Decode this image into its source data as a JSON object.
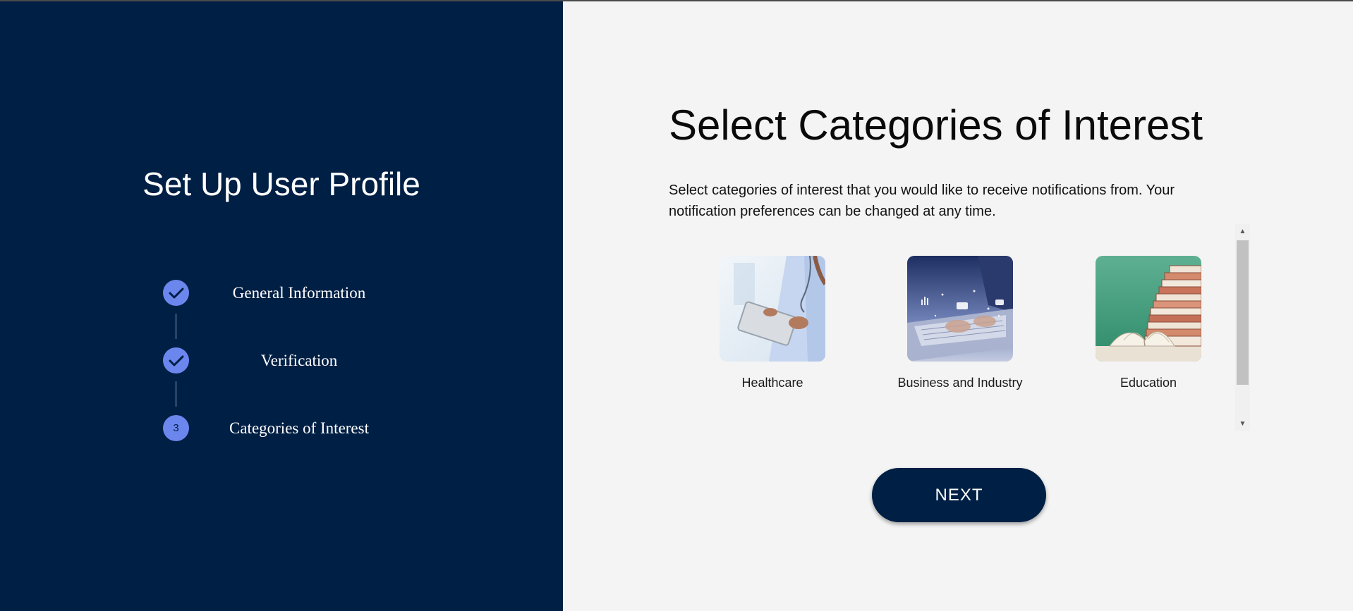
{
  "sidebar": {
    "title": "Set Up User Profile",
    "steps": [
      {
        "label": "General Information",
        "status": "complete",
        "icon": "check-icon"
      },
      {
        "label": "Verification",
        "status": "complete",
        "icon": "check-icon"
      },
      {
        "label": "Categories of Interest",
        "status": "current",
        "number": "3"
      }
    ]
  },
  "main": {
    "title": "Select Categories of Interest",
    "description": "Select categories of interest that you would like to receive notifications from. Your notification preferences can be changed at any time.",
    "categories": [
      {
        "label": "Healthcare",
        "image": "healthcare-image"
      },
      {
        "label": "Business and Industry",
        "image": "business-image"
      },
      {
        "label": "Education",
        "image": "education-image"
      }
    ],
    "next_label": "NEXT"
  },
  "colors": {
    "sidebar_bg": "#001f44",
    "step_accent": "#6b87ee",
    "main_bg": "#f4f4f4",
    "button_bg": "#001f44"
  }
}
